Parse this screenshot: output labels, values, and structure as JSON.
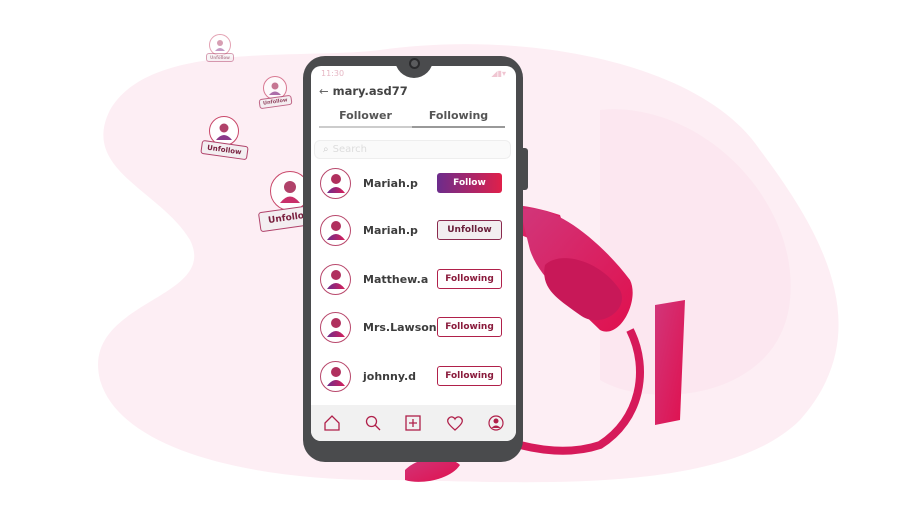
{
  "colors": {
    "accent": "#d61a5a",
    "bg_blob": "#fdeef4",
    "phone": "#4a4b4d"
  },
  "floating_cards": [
    {
      "label": "Unfollow"
    },
    {
      "label": "Unfollow"
    },
    {
      "label": "Unfollow"
    },
    {
      "label": "Unfollow"
    }
  ],
  "status_bar": {
    "time": "11:30",
    "icons": "signal-battery-wifi"
  },
  "header": {
    "back_icon": "arrow-left-icon",
    "username": "mary.asd77"
  },
  "tabs": [
    {
      "label": "Follower"
    },
    {
      "label": "Following",
      "active": true
    }
  ],
  "search": {
    "placeholder": "Search"
  },
  "list": [
    {
      "name": "Mariah.p",
      "button": "Follow",
      "style": "follow"
    },
    {
      "name": "Mariah.p",
      "button": "Unfollow",
      "style": "unf"
    },
    {
      "name": "Matthew.a",
      "button": "Following",
      "style": "fol"
    },
    {
      "name": "Mrs.Lawson",
      "button": "Following",
      "style": "fol"
    },
    {
      "name": "johnny.d",
      "button": "Following",
      "style": "fol"
    }
  ],
  "bottom_nav": [
    "home-icon",
    "search-icon",
    "add-icon",
    "heart-icon",
    "profile-icon"
  ]
}
